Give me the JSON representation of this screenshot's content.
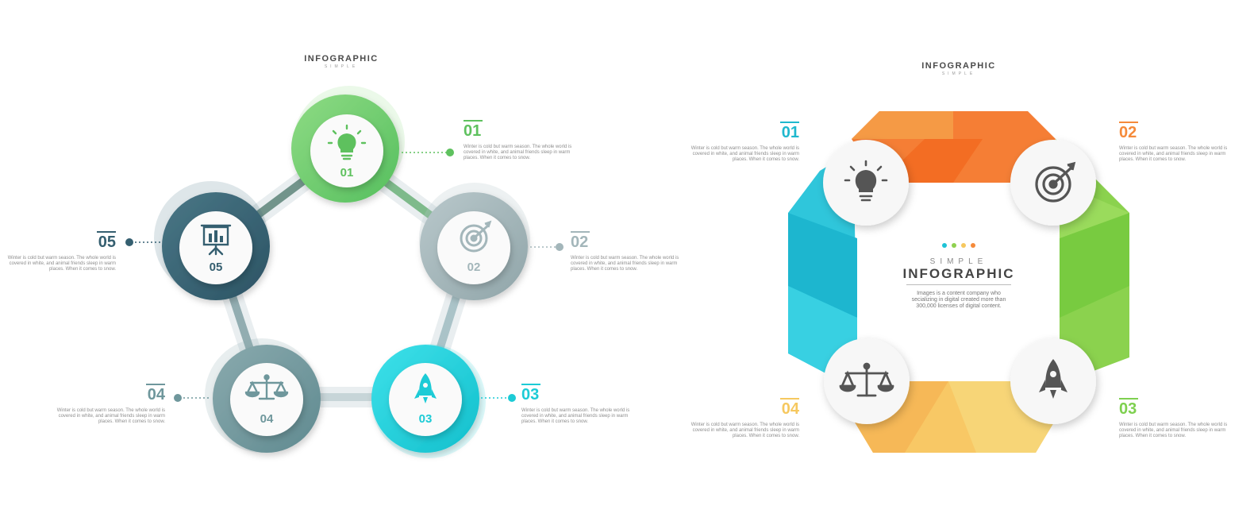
{
  "left_diagram": {
    "title": "INFOGRAPHIC",
    "subtitle": "SIMPLE",
    "nodes": [
      {
        "num": "01",
        "icon": "lightbulb-icon",
        "color": "#6CCB6B"
      },
      {
        "num": "02",
        "icon": "target-icon",
        "color": "#A3B6BA"
      },
      {
        "num": "03",
        "icon": "rocket-icon",
        "color": "#1CCBD6"
      },
      {
        "num": "04",
        "icon": "scale-icon",
        "color": "#6F979C"
      },
      {
        "num": "05",
        "icon": "presentation-chart-icon",
        "color": "#355F70"
      }
    ],
    "labels": [
      {
        "num": "01",
        "text": "Winter is cold but warm season. The whole world is covered in white, and animal friends sleep in warm places. When it comes to snow."
      },
      {
        "num": "02",
        "text": "Winter is cold but warm season. The whole world is covered in white, and animal friends sleep in warm places. When it comes to snow."
      },
      {
        "num": "03",
        "text": "Winter is cold but warm season. The whole world is covered in white, and animal friends sleep in warm places. When it comes to snow."
      },
      {
        "num": "04",
        "text": "Winter is cold but warm season. The whole world is covered in white, and animal friends sleep in warm places. When it comes to snow."
      },
      {
        "num": "05",
        "text": "Winter is cold but warm season. The whole world is covered in white, and animal friends sleep in warm places. When it comes to snow."
      }
    ]
  },
  "right_diagram": {
    "title": "INFOGRAPHIC",
    "subtitle": "SIMPLE",
    "center": {
      "subtitle": "SIMPLE",
      "title": "INFOGRAPHIC",
      "text": "Images is a content company who secializing in digital created more than 300,000 licenses of digital content.",
      "dot_colors": [
        "#1EC3D6",
        "#8FD14F",
        "#F6C85F",
        "#F58A3A"
      ]
    },
    "labels": [
      {
        "num": "01",
        "color": "#1FB8CE",
        "text": "Winter is cold but warm season. The whole world is covered in white, and animal friends sleep in warm places. When it comes to snow."
      },
      {
        "num": "02",
        "color": "#F58A3A",
        "text": "Winter is cold but warm season. The whole world is covered in white, and animal friends sleep in warm places. When it comes to snow."
      },
      {
        "num": "03",
        "color": "#7ED04F",
        "text": "Winter is cold but warm season. The whole world is covered in white, and animal friends sleep in warm places. When it comes to snow."
      },
      {
        "num": "04",
        "color": "#F6C85F",
        "text": "Winter is cold but warm season. The whole world is covered in white, and animal friends sleep in warm places. When it comes to snow."
      }
    ],
    "icons": [
      "lightbulb-icon",
      "target-icon",
      "rocket-icon",
      "scale-icon"
    ]
  }
}
